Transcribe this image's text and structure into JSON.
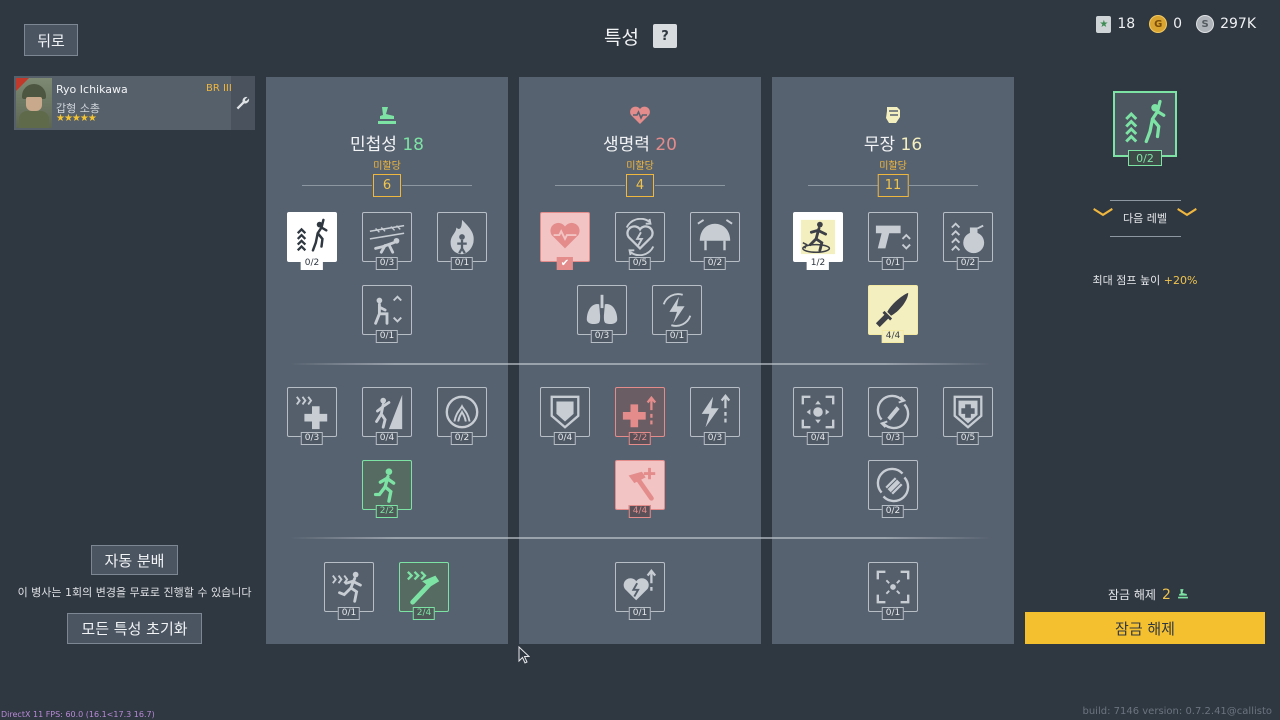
{
  "header": {
    "back_label": "뒤로",
    "title": "특성",
    "help_label": "?"
  },
  "currency": [
    {
      "icon": "star-badge-icon",
      "value": "18"
    },
    {
      "icon": "gold-coin-icon",
      "value": "0"
    },
    {
      "icon": "silver-coin-icon",
      "value": "297K"
    }
  ],
  "soldier": {
    "name": "Ryo Ichikawa",
    "class": "갑형 소총",
    "rank": "BR III",
    "stars": "★★★★★"
  },
  "left_panel": {
    "auto_label": "자동 분배",
    "free_note": "이 병사는 1회의 변경을 무료로 진행할 수 있습니다",
    "reset_label": "모든 특성 초기화"
  },
  "columns": [
    {
      "name": "민첩성",
      "value": "18",
      "sub": "미할당",
      "points": "6",
      "icon": "agility-icon",
      "perks": [
        {
          "icon": "jump-height-icon",
          "count": "0/2",
          "state": "sel"
        },
        {
          "icon": "crawl-barbed-wire-icon",
          "count": "0/3",
          "state": ""
        },
        {
          "icon": "fire-resistance-icon",
          "count": "0/1",
          "state": ""
        },
        {
          "icon": "crouch-speed-icon",
          "count": "0/1",
          "state": ""
        },
        {
          "icon": "heal-speed-icon",
          "count": "0/3",
          "state": ""
        },
        {
          "icon": "climb-icon",
          "count": "0/4",
          "state": ""
        },
        {
          "icon": "stamina-recovery-icon",
          "count": "0/2",
          "state": ""
        },
        {
          "icon": "run-speed-icon",
          "count": "2/2",
          "state": "green"
        },
        {
          "icon": "sprint-icon",
          "count": "0/1",
          "state": ""
        },
        {
          "icon": "build-speed-icon",
          "count": "2/4",
          "state": "green"
        }
      ]
    },
    {
      "name": "생명력",
      "value": "20",
      "sub": "미할당",
      "points": "4",
      "icon": "vitality-icon",
      "perks": [
        {
          "icon": "heart-check-icon",
          "count": "",
          "state": "red filled"
        },
        {
          "icon": "revive-icon",
          "count": "0/5",
          "state": ""
        },
        {
          "icon": "helmet-icon",
          "count": "0/2",
          "state": ""
        },
        {
          "icon": "lungs-icon",
          "count": "0/3",
          "state": ""
        },
        {
          "icon": "energy-recharge-icon",
          "count": "0/1",
          "state": ""
        },
        {
          "icon": "armor-icon",
          "count": "0/4",
          "state": ""
        },
        {
          "icon": "medkit-boost-icon",
          "count": "2/2",
          "state": "red"
        },
        {
          "icon": "energy-boost-icon",
          "count": "0/3",
          "state": ""
        },
        {
          "icon": "hammer-heal-icon",
          "count": "4/4",
          "state": "red"
        },
        {
          "icon": "heart-boost-icon",
          "count": "0/1",
          "state": ""
        }
      ]
    },
    {
      "name": "무장",
      "value": "16",
      "sub": "미할당",
      "points": "11",
      "icon": "weaponry-icon",
      "perks": [
        {
          "icon": "tactical-run-icon",
          "count": "1/2",
          "state": "sel"
        },
        {
          "icon": "pistol-swap-icon",
          "count": "0/1",
          "state": ""
        },
        {
          "icon": "grenade-count-icon",
          "count": "0/2",
          "state": ""
        },
        {
          "icon": "melee-knife-icon",
          "count": "4/4",
          "state": "yellow"
        },
        {
          "icon": "aim-steady-icon",
          "count": "0/4",
          "state": ""
        },
        {
          "icon": "reload-speed-icon",
          "count": "0/3",
          "state": ""
        },
        {
          "icon": "medic-shield-icon",
          "count": "0/5",
          "state": ""
        },
        {
          "icon": "ammo-pouch-icon",
          "count": "0/2",
          "state": ""
        },
        {
          "icon": "focus-icon",
          "count": "0/1",
          "state": ""
        }
      ]
    }
  ],
  "right_panel": {
    "preview_count": "0/2",
    "next_level_label": "다음 레벨",
    "effect_text": "최대 점프 높이",
    "effect_value": "+20%",
    "unlock_cost_label": "잠금 해제",
    "unlock_cost_value": "2",
    "unlock_button": "잠금 해제"
  },
  "footer": {
    "fps": "DirectX 11 FPS: 60.0 (16.1<17.3 16.7)",
    "build": "build: 7146 version: 0.7.2.41@callisto"
  },
  "colors": {
    "agility": "#7de3a4",
    "vitality": "#e48c8c",
    "weaponry": "#f4efbf",
    "accent": "#f5c030"
  }
}
